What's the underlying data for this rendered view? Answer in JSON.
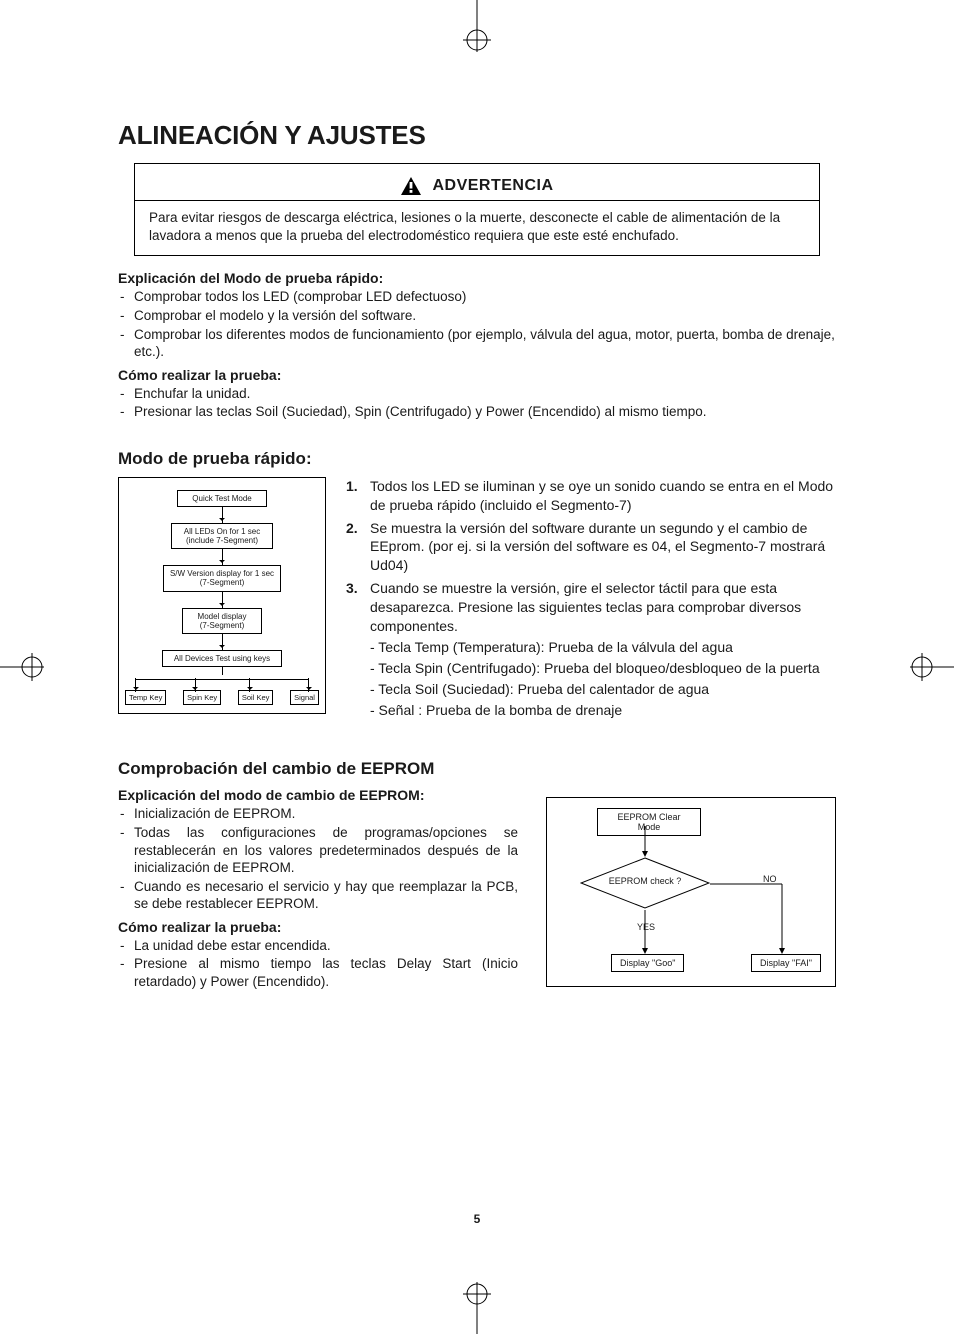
{
  "page_title": "ALINEACIÓN Y AJUSTES",
  "warning": {
    "label": "ADVERTENCIA",
    "body": "Para evitar riesgos de descarga eléctrica, lesiones o la muerte, desconecte el cable de alimentación de la lavadora a menos que la prueba del electrodoméstico requiera que este esté enchufado."
  },
  "quicktest": {
    "explanation_heading": "Explicación del Modo de prueba rápido:",
    "explanation_items": [
      "Comprobar todos los LED (comprobar LED defectuoso)",
      "Comprobar el modelo y la versión del software.",
      "Comprobar los diferentes modos de funcionamiento (por ejemplo, válvula del agua, motor, puerta, bomba de drenaje, etc.)."
    ],
    "howto_heading": "Cómo realizar la prueba:",
    "howto_items": [
      "Enchufar la unidad.",
      "Presionar las teclas Soil (Suciedad), Spin (Centrifugado) y Power (Encendido) al mismo tiempo."
    ],
    "section_heading": "Modo de prueba rápido:",
    "diagram": {
      "n1": "Quick Test Mode",
      "n2": "All LEDs On for 1 sec\n(include 7-Segment)",
      "n3": "S/W Version display for 1 sec\n(7-Segment)",
      "n4": "Model display\n(7-Segment)",
      "n5": "All Devices Test using keys",
      "k1": "Temp Key",
      "k2": "Spin Key",
      "k3": "Soil Key",
      "k4": "Signal"
    },
    "steps": {
      "s1": "Todos los LED se iluminan y se oye un sonido cuando se entra en el Modo de prueba rápido (incluido el Segmento-7)",
      "s2": "Se muestra la versión del software durante un segundo y el cambio de EEprom. (por ej. si la versión del software es 04, el Segmento-7 mostrará Ud04)",
      "s3_intro": "Cuando se muestre la versión, gire el selector táctil para que esta desaparezca. Presione las siguientes teclas para comprobar diversos componentes.",
      "s3_sub": [
        "- Tecla Temp (Temperatura): Prueba de la válvula del agua",
        "- Tecla Spin (Centrifugado): Prueba del bloqueo/desbloqueo de la puerta",
        "- Tecla Soil (Suciedad): Prueba del calentador de agua",
        "- Señal : Prueba de la bomba de drenaje"
      ]
    }
  },
  "eeprom": {
    "heading": "Comprobación del cambio de EEPROM",
    "explanation_heading": "Explicación del modo de cambio de EEPROM:",
    "explanation_items": [
      "Inicialización de EEPROM.",
      "Todas las configuraciones de programas/opciones se restablecerán en los valores predeterminados después de la inicialización de EEPROM.",
      "Cuando es necesario el servicio y hay que reemplazar la PCB, se debe restablecer EEPROM."
    ],
    "howto_heading": "Cómo realizar la prueba:",
    "howto_items": [
      "La unidad debe estar encendida.",
      "Presione al mismo tiempo las teclas Delay Start (Inicio retardado) y Power (Encendido)."
    ],
    "diagram": {
      "n1": "EEPROM Clear Mode",
      "decision": "EEPROM check ?",
      "yes": "YES",
      "no": "NO",
      "goo": "Display \"Goo\"",
      "fail": "Display \"FAI\""
    }
  },
  "page_number": "5"
}
